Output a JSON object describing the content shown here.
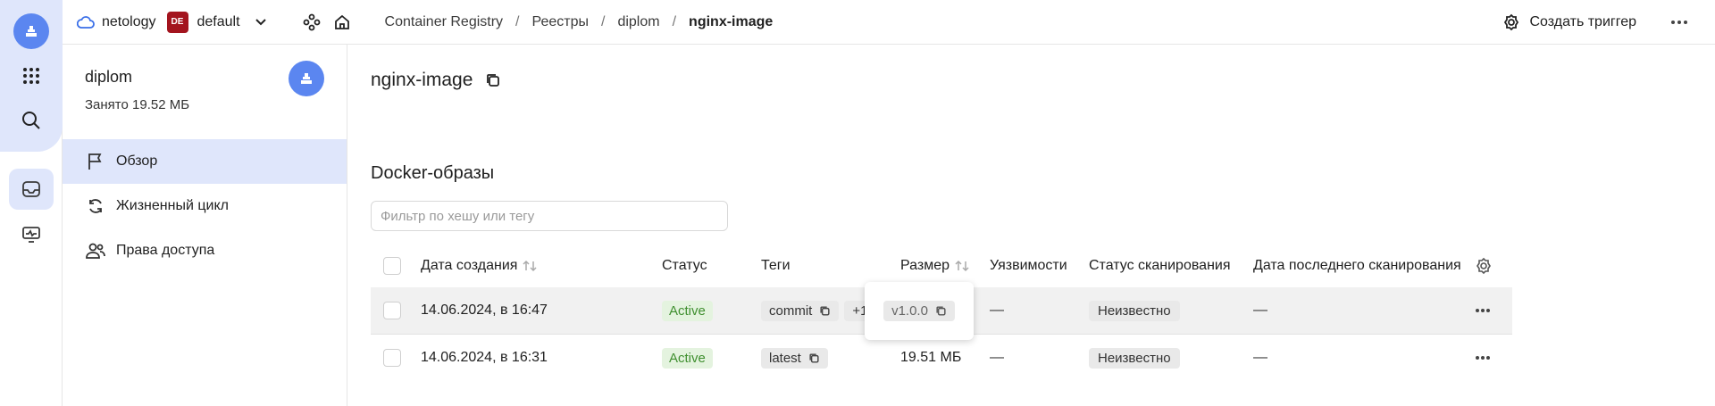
{
  "topbar": {
    "cloud_name": "netology",
    "folder_badge": "DE",
    "folder_name": "default",
    "breadcrumbs": [
      "Container Registry",
      "Реестры",
      "diplom",
      "nginx-image"
    ],
    "trigger_label": "Создать триггер"
  },
  "sidebar": {
    "title": "diplom",
    "subtitle": "Занято 19.52 МБ",
    "items": [
      {
        "label": "Обзор",
        "icon": "flag-icon",
        "active": true
      },
      {
        "label": "Жизненный цикл",
        "icon": "refresh-icon",
        "active": false
      },
      {
        "label": "Права доступа",
        "icon": "users-icon",
        "active": false
      }
    ]
  },
  "main": {
    "title": "nginx-image",
    "section_title": "Docker-образы",
    "filter_placeholder": "Фильтр по хешу или тегу",
    "columns": [
      "Дата создания",
      "Статус",
      "Теги",
      "Размер",
      "Уязвимости",
      "Статус сканирования",
      "Дата последнего сканирования"
    ],
    "rows": [
      {
        "created": "14.06.2024, в 16:47",
        "status": "Active",
        "tag": "commit",
        "extra_tags": "+1",
        "size": "",
        "vulns": "—",
        "scan_status": "Неизвестно",
        "last_scan": "—"
      },
      {
        "created": "14.06.2024, в 16:31",
        "status": "Active",
        "tag": "latest",
        "extra_tags": "",
        "size": "19.51 МБ",
        "vulns": "—",
        "scan_status": "Неизвестно",
        "last_scan": "—"
      }
    ],
    "popup_tag": "v1.0.0"
  },
  "colors": {
    "accent": "#5b86f0",
    "active_bg": "#dfe6fb",
    "status_green": "#3f8f2f",
    "folder_badge": "#a3141e"
  }
}
